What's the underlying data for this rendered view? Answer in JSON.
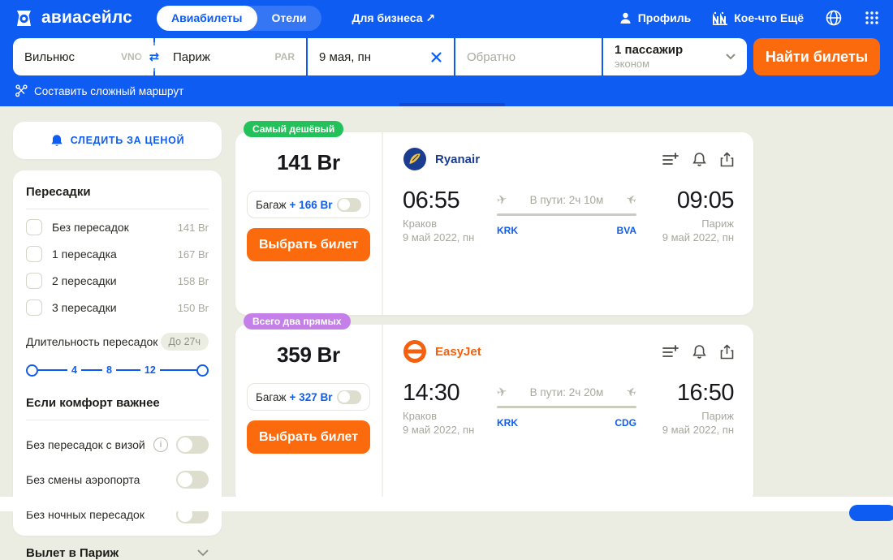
{
  "colors": {
    "brand_blue": "#0f5cf2",
    "progress_blue": "#1a46c9",
    "orange": "#fb6a0d",
    "green": "#23c159",
    "purple": "#c480e8",
    "bg": "#ebede3"
  },
  "header": {
    "logo_text": "авиасейлс",
    "nav": {
      "flights": "Авиабилеты",
      "hotels": "Отели",
      "business": "Для бизнеса ↗"
    },
    "profile": "Профиль",
    "more": "Кое-что Ещё"
  },
  "search": {
    "origin": {
      "city": "Вильнюс",
      "code": "VNO"
    },
    "destination": {
      "city": "Париж",
      "code": "PAR"
    },
    "depart_date": "9 мая, пн",
    "return_placeholder": "Обратно",
    "passengers": {
      "count": "1 пассажир",
      "class": "эконом"
    },
    "submit": "Найти билеты",
    "complex_route": "Составить сложный маршрут"
  },
  "sidebar": {
    "watch_price": "СЛЕДИТЬ ЗА ЦЕНОЙ",
    "transfers": {
      "title": "Пересадки",
      "options": [
        {
          "label": "Без пересадок",
          "price": "141 Br"
        },
        {
          "label": "1 пересадка",
          "price": "167 Br"
        },
        {
          "label": "2 пересадки",
          "price": "158 Br"
        },
        {
          "label": "3 пересадки",
          "price": "150 Br"
        }
      ]
    },
    "duration": {
      "label": "Длительность пересадок",
      "badge": "До 27ч",
      "ticks": [
        "4",
        "8",
        "12"
      ]
    },
    "comfort": {
      "title": "Если комфорт важнее",
      "toggles": [
        {
          "label": "Без пересадок с визой"
        },
        {
          "label": "Без смены аэропорта"
        },
        {
          "label": "Без ночных пересадок"
        }
      ]
    },
    "departure_section": "Вылет в Париж"
  },
  "results": [
    {
      "badge": "Самый дешёвый",
      "price": "141 Br",
      "baggage": {
        "label": "Багаж",
        "price": "+ 166 Br"
      },
      "select": "Выбрать билет",
      "airline": "Ryanair",
      "duration": "В пути: 2ч 10м",
      "depart": {
        "time": "06:55",
        "city": "Краков",
        "date": "9 май 2022, пн",
        "code": "KRK"
      },
      "arrive": {
        "time": "09:05",
        "city": "Париж",
        "date": "9 май 2022, пн",
        "code": "BVA"
      }
    },
    {
      "badge": "Всего два прямых",
      "price": "359 Br",
      "baggage": {
        "label": "Багаж",
        "price": "+ 327 Br"
      },
      "select": "Выбрать билет",
      "airline": "EasyJet",
      "duration": "В пути: 2ч 20м",
      "depart": {
        "time": "14:30",
        "city": "Краков",
        "date": "9 май 2022, пн",
        "code": "KRK"
      },
      "arrive": {
        "time": "16:50",
        "city": "Париж",
        "date": "9 май 2022, пн",
        "code": "CDG"
      }
    }
  ]
}
